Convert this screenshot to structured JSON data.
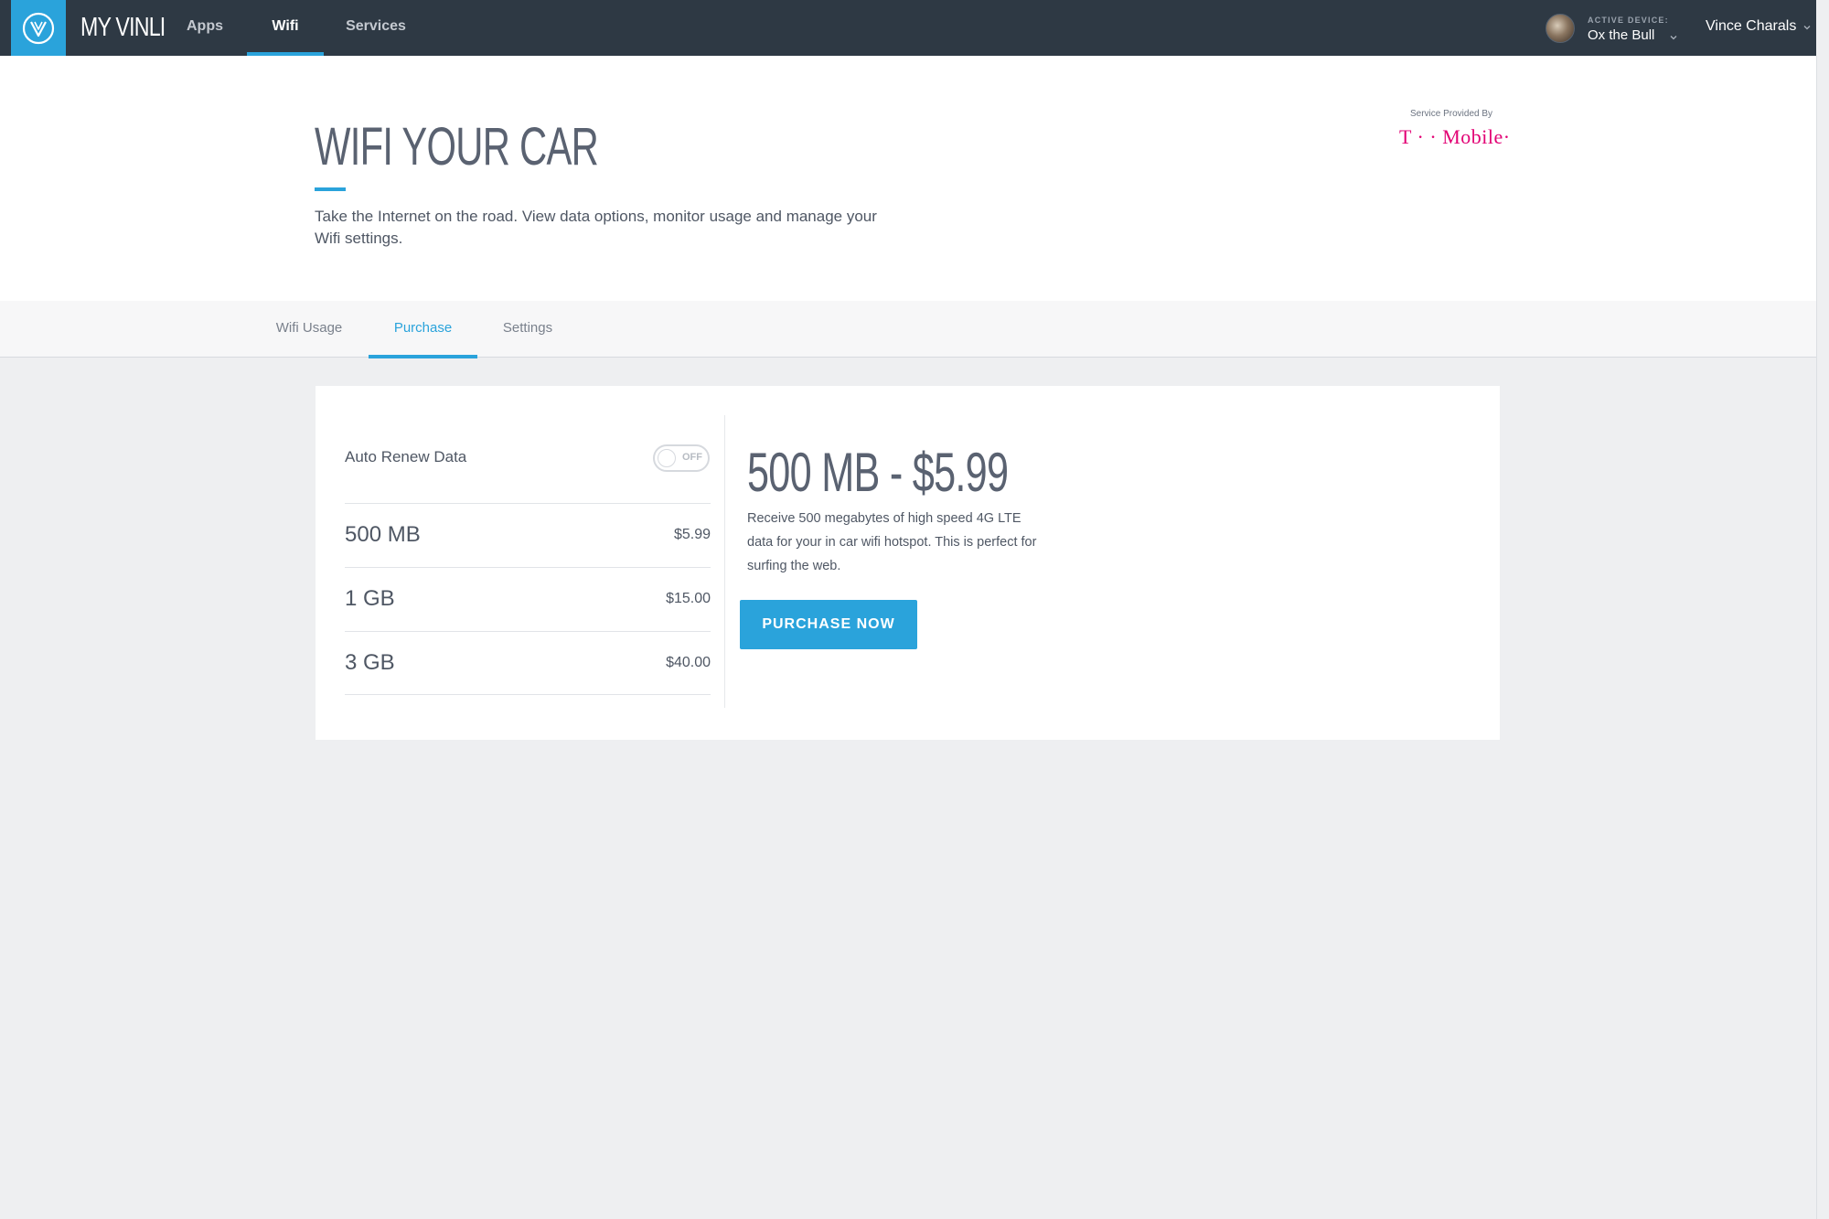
{
  "nav": {
    "brand": "MY VINLI",
    "items": [
      {
        "label": "Apps",
        "active": false
      },
      {
        "label": "Wifi",
        "active": true
      },
      {
        "label": "Services",
        "active": false
      }
    ],
    "active_device_label": "ACTIVE DEVICE:",
    "active_device_name": "Ox the Bull",
    "user_name": "Vince Charals"
  },
  "header": {
    "title": "WIFI YOUR CAR",
    "description": "Take the Internet on the road. View data options, monitor usage and manage your Wifi settings.",
    "provider_label": "Service Provided By",
    "provider_name": "T · · Mobile·"
  },
  "subtabs": [
    {
      "label": "Wifi Usage",
      "active": false
    },
    {
      "label": "Purchase",
      "active": true
    },
    {
      "label": "Settings",
      "active": false
    }
  ],
  "purchase": {
    "auto_renew_label": "Auto Renew Data",
    "auto_renew_state": "OFF",
    "plans": [
      {
        "name": "500 MB",
        "price": "$5.99"
      },
      {
        "name": "1 GB",
        "price": "$15.00"
      },
      {
        "name": "3 GB",
        "price": "$40.00"
      }
    ],
    "selected_title": "500 MB - $5.99",
    "selected_description": "Receive 500 megabytes of high speed 4G LTE data for your in car wifi hotspot. This is perfect for surfing the web.",
    "button_label": "PURCHASE NOW"
  },
  "colors": {
    "accent": "#2aa3db",
    "topbar": "#2e3944",
    "provider_brand": "#e20074"
  }
}
